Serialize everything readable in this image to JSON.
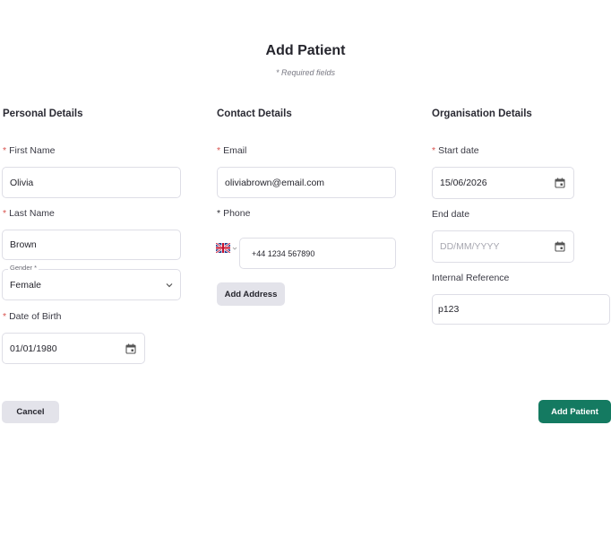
{
  "page": {
    "title": "Add Patient",
    "required_note": "* Required fields"
  },
  "personal": {
    "heading": "Personal Details",
    "first_name": {
      "label": "First Name",
      "required": "*",
      "value": "Olivia"
    },
    "last_name": {
      "label": "Last Name",
      "required": "*",
      "value": "Brown"
    },
    "gender": {
      "label": "Gender *",
      "value": "Female"
    },
    "dob": {
      "label": "Date of Birth",
      "required": "*",
      "value": "01/01/1980"
    }
  },
  "contact": {
    "heading": "Contact Details",
    "email": {
      "label": "Email",
      "required": "*",
      "value": "oliviabrown@email.com"
    },
    "phone": {
      "label": "Phone",
      "required": "*",
      "value": "+44 1234 567890",
      "country_icon": "uk-flag-icon"
    },
    "add_address_label": "Add Address"
  },
  "organisation": {
    "heading": "Organisation Details",
    "start_date": {
      "label": "Start date",
      "required": "*",
      "value": "15/06/2026"
    },
    "end_date": {
      "label": "End date",
      "placeholder": "DD/MM/YYYY"
    },
    "internal_reference": {
      "label": "Internal Reference",
      "value": "p123"
    }
  },
  "actions": {
    "cancel_label": "Cancel",
    "submit_label": "Add Patient"
  },
  "colors": {
    "accent": "#147a61",
    "required_star": "#d9534f",
    "secondary_button": "#e3e3ea"
  }
}
